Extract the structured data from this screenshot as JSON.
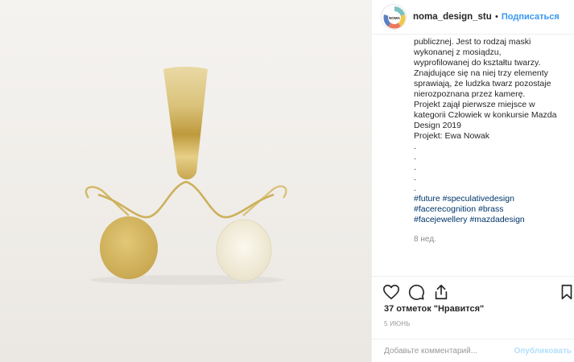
{
  "post": {
    "photo": {
      "alt_icon": "brass-face-jewellery-photo"
    },
    "header": {
      "username": "noma_design_studi",
      "separator": "•",
      "follow_label": "Подписаться",
      "avatar_text": "NOMA"
    },
    "caption": {
      "lines": [
        "publicznej. Jest to rodzaj maski",
        "wykonanej z mosiądzu,",
        "wyprofilowanej do kształtu twarzy.",
        "Znajdujące się na niej trzy elementy",
        "sprawiają, że ludzka twarz pozostaje",
        "nierozpoznana przez kamerę.",
        "Projekt zajął pierwsze miejsce w",
        "kategorii Człowiek w konkursie Mazda",
        "Design 2019",
        "Projekt: Ewa Nowak",
        ".",
        ".",
        ".",
        ".",
        "."
      ],
      "tags_line1": [
        "#future",
        "#speculativedesign"
      ],
      "tags_line2": [
        "#facerecognition",
        "#brass"
      ],
      "tags_line3": [
        "#facejewellery",
        "#mazdadesign"
      ],
      "time_ago": "8 нед."
    },
    "actions": {
      "like_icon": "heart-icon",
      "comment_icon": "comment-icon",
      "share_icon": "share-icon",
      "save_icon": "bookmark-icon"
    },
    "likes_text": "37 отметок \"Нравится\"",
    "date_text": "5 июнь",
    "comment": {
      "placeholder": "Добавьте комментарий...",
      "publish_label": "Опубликовать"
    },
    "colors": {
      "link": "#003569",
      "follow": "#3897f0",
      "publish_disabled": "#b2dffc",
      "brass": "#d6b85e"
    }
  }
}
